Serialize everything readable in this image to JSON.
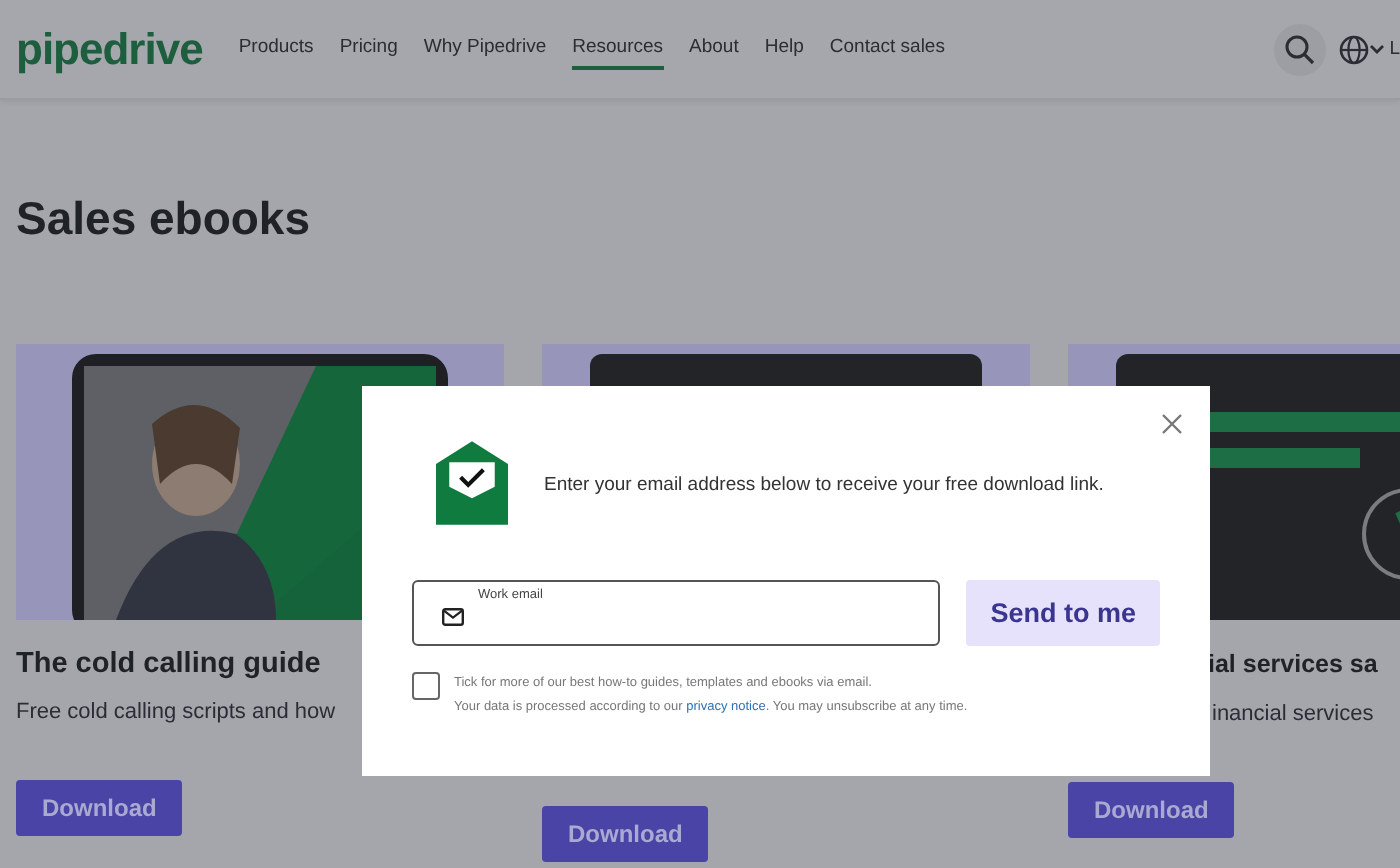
{
  "header": {
    "logo": "pipedrive",
    "nav": [
      {
        "label": "Products",
        "selected": false
      },
      {
        "label": "Pricing",
        "selected": false
      },
      {
        "label": "Why Pipedrive",
        "selected": false
      },
      {
        "label": "Resources",
        "selected": true
      },
      {
        "label": "About",
        "selected": false
      },
      {
        "label": "Help",
        "selected": false
      },
      {
        "label": "Contact sales",
        "selected": false
      }
    ],
    "language": "L"
  },
  "page_title": "Sales ebooks",
  "cards": [
    {
      "title": "The cold calling guide",
      "description": "Free cold calling scripts and how",
      "button": "Download"
    },
    {
      "button": "Download"
    },
    {
      "title": "ial services sa",
      "description": "inancial services",
      "button": "Download"
    }
  ],
  "modal": {
    "message": "Enter your email address below to receive your free download link.",
    "email_field": {
      "label": "Work email"
    },
    "submit": "Send to me",
    "opt_in": {
      "checked": false,
      "label": "Tick for more of our best how-to guides, templates and ebooks via email."
    },
    "privacy": "Your data is processed according to our ",
    "privacy_link": "privacy notice",
    "privacy_end": ". You may unsubscribe at any time."
  }
}
